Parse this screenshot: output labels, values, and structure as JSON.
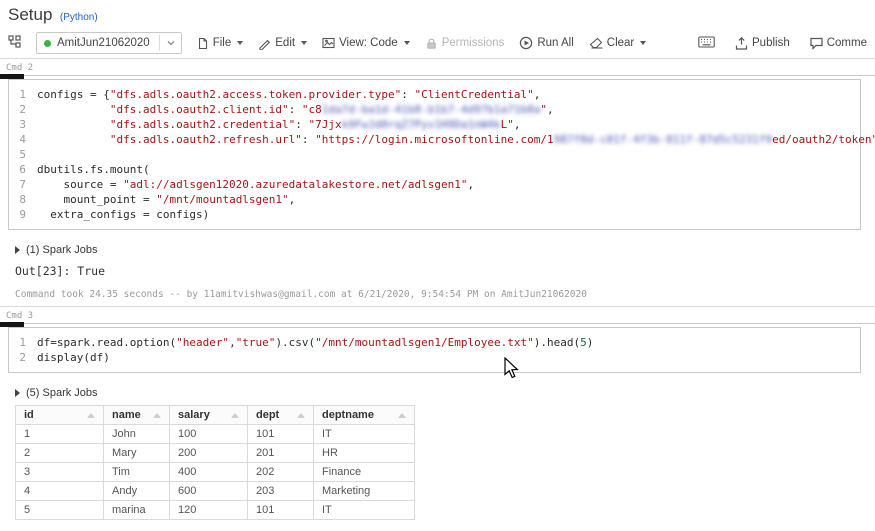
{
  "page": {
    "title": "Setup",
    "language": "(Python)"
  },
  "toolbar": {
    "cluster": "AmitJun21062020",
    "file": "File",
    "edit": "Edit",
    "view": "View: Code",
    "permissions": "Permissions",
    "run_all": "Run All",
    "clear": "Clear",
    "publish": "Publish",
    "comments": "Comme"
  },
  "cells": [
    {
      "label": "Cmd 2",
      "code": [
        [
          {
            "t": "configs = {",
            "c": "pl"
          },
          {
            "t": "\"dfs.adls.oauth2.access.token.provider.type\"",
            "c": "st"
          },
          {
            "t": ": ",
            "c": "pl"
          },
          {
            "t": "\"ClientCredential\"",
            "c": "st"
          },
          {
            "t": ",",
            "c": "pl"
          }
        ],
        [
          {
            "t": "           ",
            "c": "pl"
          },
          {
            "t": "\"dfs.adls.oauth2.client.id\"",
            "c": "st"
          },
          {
            "t": ": ",
            "c": "pl"
          },
          {
            "t": "\"c8",
            "c": "st"
          },
          {
            "t": "1da7d-ba1d-41b8-b1b7-4d97b1a71b8a",
            "c": "bl"
          },
          {
            "t": "\"",
            "c": "st"
          },
          {
            "t": ",",
            "c": "pl"
          }
        ],
        [
          {
            "t": "           ",
            "c": "pl"
          },
          {
            "t": "\"dfs.adls.oauth2.credential\"",
            "c": "st"
          },
          {
            "t": ": ",
            "c": "pl"
          },
          {
            "t": "\"7Jjx",
            "c": "st"
          },
          {
            "t": "k9FwJd0rqZ7Pyv1H9Da1nW4k",
            "c": "bl"
          },
          {
            "t": "L\"",
            "c": "st"
          },
          {
            "t": ",",
            "c": "pl"
          }
        ],
        [
          {
            "t": "           ",
            "c": "pl"
          },
          {
            "t": "\"dfs.adls.oauth2.refresh.url\"",
            "c": "st"
          },
          {
            "t": ": ",
            "c": "pl"
          },
          {
            "t": "\"https://login.microsoftonline.com/1",
            "c": "st"
          },
          {
            "t": "987f8d-c01f-4f3b-811f-87d5c5231f9",
            "c": "bl"
          },
          {
            "t": "ed/oauth2/token\"",
            "c": "st"
          },
          {
            "t": "}",
            "c": "pl"
          }
        ],
        [
          {
            "t": " ",
            "c": "pl"
          }
        ],
        [
          {
            "t": "dbutils.fs.mount(",
            "c": "pl"
          }
        ],
        [
          {
            "t": "    source = ",
            "c": "pl"
          },
          {
            "t": "\"adl://adlsgen12020.azuredatalakestore.net/adlsgen1\"",
            "c": "st"
          },
          {
            "t": ",",
            "c": "pl"
          }
        ],
        [
          {
            "t": "    mount_point = ",
            "c": "pl"
          },
          {
            "t": "\"/mnt/mountadlsgen1\"",
            "c": "st"
          },
          {
            "t": ",",
            "c": "pl"
          }
        ],
        [
          {
            "t": "  extra_configs = configs)",
            "c": "pl"
          }
        ]
      ],
      "spark_jobs": "(1) Spark Jobs",
      "output": "Out[23]: True",
      "footer": "Command took 24.35 seconds -- by 11amitvishwas@gmail.com at 6/21/2020, 9:54:54 PM on AmitJun21062020"
    },
    {
      "label": "Cmd 3",
      "code": [
        [
          {
            "t": "df=spark.read.option(",
            "c": "pl"
          },
          {
            "t": "\"header\"",
            "c": "st"
          },
          {
            "t": ",",
            "c": "pl"
          },
          {
            "t": "\"true\"",
            "c": "st"
          },
          {
            "t": ").csv(",
            "c": "pl"
          },
          {
            "t": "\"/mnt/mountadlsgen1/Employee.txt\"",
            "c": "st"
          },
          {
            "t": ").head(",
            "c": "pl"
          },
          {
            "t": "5",
            "c": "nu"
          },
          {
            "t": ")",
            "c": "pl"
          }
        ],
        [
          {
            "t": "display(df)",
            "c": "pl"
          }
        ]
      ],
      "spark_jobs": "(5) Spark Jobs",
      "table": {
        "columns": [
          "id",
          "name",
          "salary",
          "dept",
          "deptname"
        ],
        "rows": [
          [
            "1",
            "John",
            "100",
            "101",
            "IT"
          ],
          [
            "2",
            "Mary",
            "200",
            "201",
            "HR"
          ],
          [
            "3",
            "Tim",
            "400",
            "202",
            "Finance"
          ],
          [
            "4",
            "Andy",
            "600",
            "203",
            "Marketing"
          ],
          [
            "5",
            "marina",
            "120",
            "101",
            "IT"
          ]
        ]
      }
    }
  ]
}
